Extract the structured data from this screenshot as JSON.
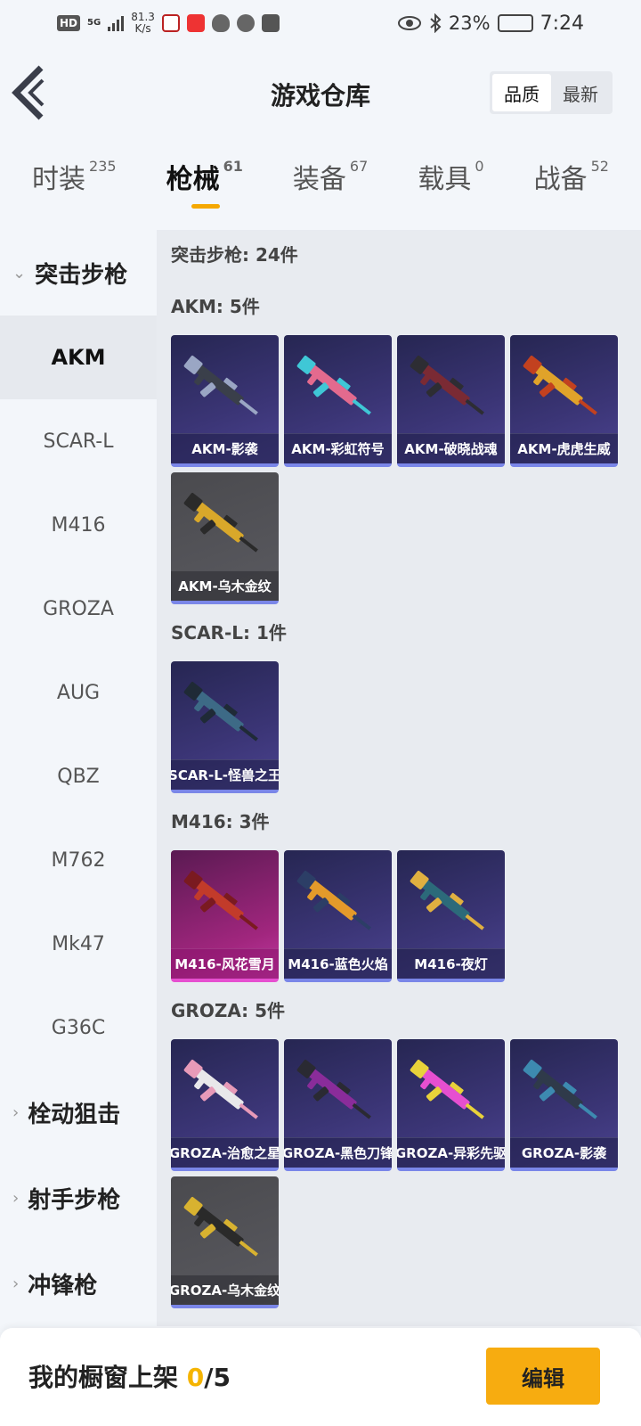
{
  "status_bar": {
    "hd": "HD",
    "network": "5G",
    "speed_value": "81.3",
    "speed_unit": "K/s",
    "battery": "23%",
    "time": "7:24"
  },
  "header": {
    "title": "游戏仓库",
    "sort": [
      "品质",
      "最新"
    ]
  },
  "tabs": [
    {
      "label": "时装",
      "count": "235"
    },
    {
      "label": "枪械",
      "count": "61"
    },
    {
      "label": "装备",
      "count": "67"
    },
    {
      "label": "载具",
      "count": "0"
    },
    {
      "label": "战备",
      "count": "52"
    }
  ],
  "sidebar": {
    "group_open": "突击步枪",
    "items": [
      "AKM",
      "SCAR-L",
      "M416",
      "GROZA",
      "AUG",
      "QBZ",
      "M762",
      "Mk47",
      "G36C"
    ],
    "groups_closed": [
      "栓动狙击",
      "射手步枪",
      "冲锋枪"
    ]
  },
  "content": {
    "summary": "突击步枪: 24件",
    "sections": [
      {
        "head": "AKM: 5件",
        "items": [
          {
            "name": "AKM-影袭",
            "style": "purple",
            "gun": "#3a3f4a",
            "accent": "#9aa6c4"
          },
          {
            "name": "AKM-彩虹符号",
            "style": "purple",
            "gun": "#e36a8e",
            "accent": "#3fc7d6"
          },
          {
            "name": "AKM-破晓战魂",
            "style": "purple",
            "gun": "#7a2a34",
            "accent": "#2d2d33"
          },
          {
            "name": "AKM-虎虎生威",
            "style": "purple",
            "gun": "#e0a32a",
            "accent": "#c2411f"
          },
          {
            "name": "AKM-乌木金纹",
            "style": "grey",
            "gun": "#d9a82a",
            "accent": "#2a2a2a"
          }
        ]
      },
      {
        "head": "SCAR-L: 1件",
        "items": [
          {
            "name": "SCAR-L-怪兽之王",
            "style": "purple",
            "gun": "#3d6a86",
            "accent": "#1f2a36"
          }
        ]
      },
      {
        "head": "M416: 3件",
        "items": [
          {
            "name": "M416-风花雪月",
            "style": "pink",
            "gun": "#c23b2a",
            "accent": "#7a1a20"
          },
          {
            "name": "M416-蓝色火焰",
            "style": "purple",
            "gun": "#e39a2a",
            "accent": "#2c3e66"
          },
          {
            "name": "M416-夜灯",
            "style": "purple",
            "gun": "#2c6a7a",
            "accent": "#e0b040"
          }
        ]
      },
      {
        "head": "GROZA: 5件",
        "items": [
          {
            "name": "GROZA-治愈之星",
            "style": "purple",
            "gun": "#e8e8ea",
            "accent": "#e79ab8"
          },
          {
            "name": "GROZA-黑色刀锋",
            "style": "purple",
            "gun": "#8a2c9a",
            "accent": "#2a2a32"
          },
          {
            "name": "GROZA-异彩先驱",
            "style": "purple",
            "gun": "#e64fd0",
            "accent": "#e8d23a"
          },
          {
            "name": "GROZA-影袭",
            "style": "purple",
            "gun": "#2f3a4a",
            "accent": "#3d8ab0"
          },
          {
            "name": "GROZA-乌木金纹",
            "style": "grey",
            "gun": "#2a2a2a",
            "accent": "#d8b230"
          }
        ]
      }
    ]
  },
  "footer": {
    "label": "我的橱窗上架",
    "current": "0",
    "total": "/5",
    "edit": "编辑"
  }
}
